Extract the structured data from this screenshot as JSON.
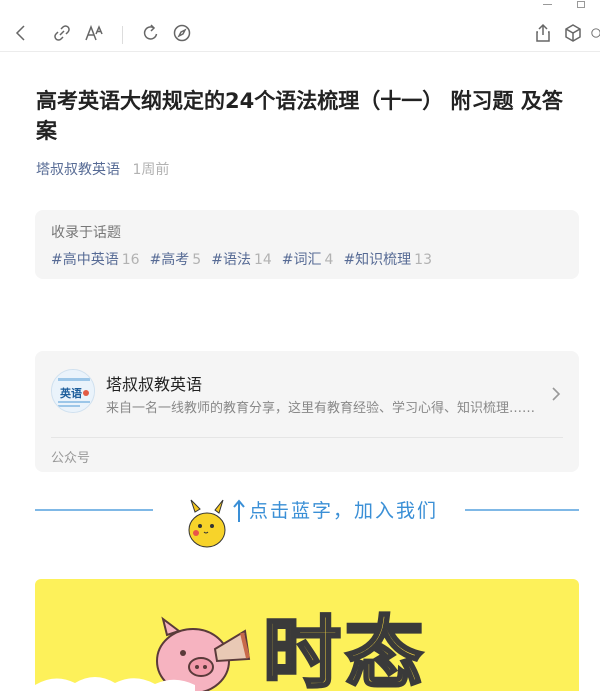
{
  "toolbar": {
    "back_icon": "chevron-left-icon",
    "link_icon": "link-icon",
    "font_icon": "font-size-icon",
    "refresh_icon": "refresh-icon",
    "compass_icon": "compass-icon",
    "share_icon": "share-icon",
    "box_icon": "cube-icon"
  },
  "article": {
    "title": "高考英语大纲规定的24个语法梳理（十一） 附习题 及答案",
    "author": "塔叔叔教英语",
    "time": "1周前"
  },
  "topics": {
    "label": "收录于话题",
    "items": [
      {
        "name": "#高中英语",
        "count": "16"
      },
      {
        "name": "#高考",
        "count": "5"
      },
      {
        "name": "#语法",
        "count": "14"
      },
      {
        "name": "#词汇",
        "count": "4"
      },
      {
        "name": "#知识梳理",
        "count": "13"
      }
    ]
  },
  "account": {
    "name": "塔叔叔教英语",
    "description": "来自一名一线教师的教育分享，这里有教育经验、学习心得、知识梳理……",
    "type": "公众号",
    "avatar_text": "英语"
  },
  "banner": {
    "text": "点击蓝字，加入我们",
    "big_text": "时态"
  },
  "colors": {
    "link": "#576b95",
    "banner_blue": "#3a8fd6",
    "banner_yellow": "#fdf15a"
  }
}
